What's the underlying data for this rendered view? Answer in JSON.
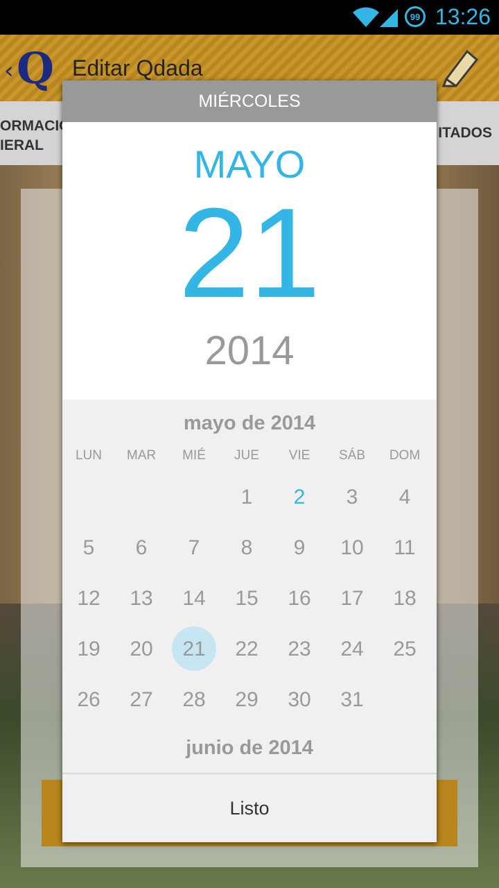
{
  "status_bar": {
    "time": "13:26",
    "battery": "99",
    "icons": [
      "wifi-icon",
      "signal-icon",
      "battery-icon"
    ],
    "accent": "#33b5e5"
  },
  "background_app": {
    "title": "Editar Qdada",
    "logo_letter": "Q",
    "tab_left_line1": "ORMACIÓ",
    "tab_left_line2": "IERAL",
    "tab_right": "ITADOS",
    "icons": [
      "back-chevron-icon",
      "app-logo-icon",
      "pencil-icon"
    ]
  },
  "dialog": {
    "day_of_week": "MIÉRCOLES",
    "month": "MAYO",
    "day": "21",
    "year": "2014",
    "calendar": {
      "title": "mayo de 2014",
      "weekdays": [
        "LUN",
        "MAR",
        "MIÉ",
        "JUE",
        "VIE",
        "SÁB",
        "DOM"
      ],
      "weeks": [
        [
          "",
          "",
          "",
          "1",
          "2",
          "3",
          "4"
        ],
        [
          "5",
          "6",
          "7",
          "8",
          "9",
          "10",
          "11"
        ],
        [
          "12",
          "13",
          "14",
          "15",
          "16",
          "17",
          "18"
        ],
        [
          "19",
          "20",
          "21",
          "22",
          "23",
          "24",
          "25"
        ],
        [
          "26",
          "27",
          "28",
          "29",
          "30",
          "31",
          ""
        ]
      ],
      "today": "2",
      "selected": "21",
      "next_month_title": "junio de 2014"
    },
    "done_label": "Listo",
    "colors": {
      "accent": "#33b5e5",
      "header": "#999999",
      "selected_bg": "#c7e6f3"
    }
  }
}
